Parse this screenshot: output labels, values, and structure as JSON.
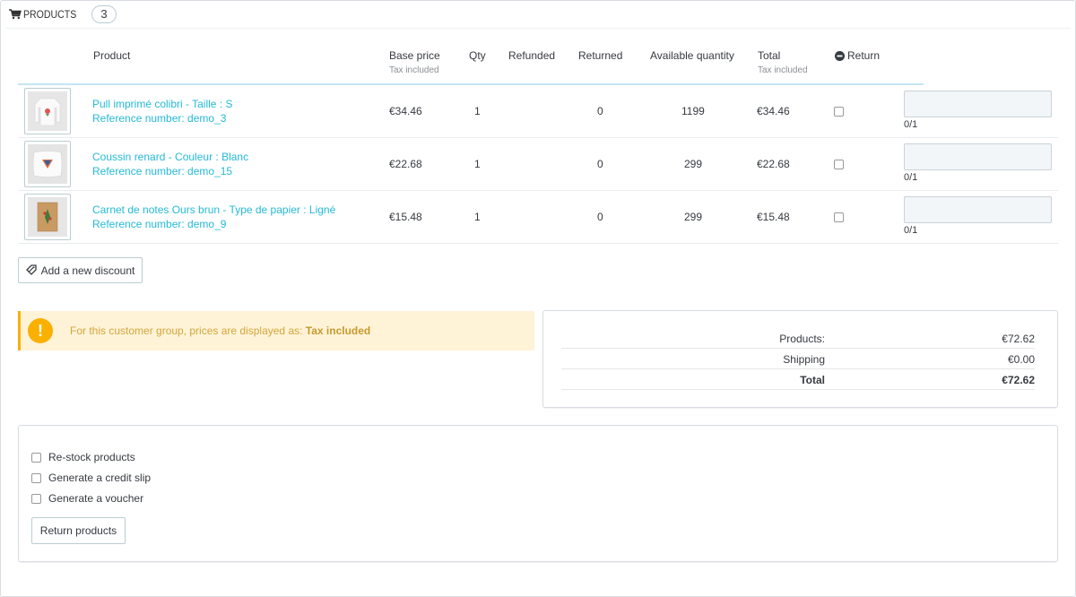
{
  "panel": {
    "title": "Products",
    "count": "3"
  },
  "table": {
    "headers": {
      "product": "Product",
      "base_price": "Base price",
      "base_price_sub": "Tax included",
      "qty": "Qty",
      "refunded": "Refunded",
      "returned": "Returned",
      "available": "Available quantity",
      "total": "Total",
      "total_sub": "Tax included",
      "return": "Return"
    },
    "rows": [
      {
        "name": "Pull imprimé colibri - Taille : S",
        "ref": "Reference number: demo_3",
        "price": "€34.46",
        "qty": "1",
        "refunded": "",
        "returned": "0",
        "available": "1199",
        "total": "€34.46",
        "return_count": "0/1"
      },
      {
        "name": "Coussin renard - Couleur : Blanc",
        "ref": "Reference number: demo_15",
        "price": "€22.68",
        "qty": "1",
        "refunded": "",
        "returned": "0",
        "available": "299",
        "total": "€22.68",
        "return_count": "0/1"
      },
      {
        "name": "Carnet de notes Ours brun - Type de papier : Ligné",
        "ref": "Reference number: demo_9",
        "price": "€15.48",
        "qty": "1",
        "refunded": "",
        "returned": "0",
        "available": "299",
        "total": "€15.48",
        "return_count": "0/1"
      }
    ]
  },
  "actions": {
    "add_discount": "Add a new discount",
    "return_products": "Return products"
  },
  "alert": {
    "text": "For this customer group, prices are displayed as: ",
    "strong": "Tax included"
  },
  "totals": {
    "products_label": "Products:",
    "products_value": "€72.62",
    "shipping_label": "Shipping",
    "shipping_value": "€0.00",
    "total_label": "Total",
    "total_value": "€72.62"
  },
  "options": {
    "restock": "Re-stock products",
    "credit_slip": "Generate a credit slip",
    "voucher": "Generate a voucher"
  },
  "colors": {
    "link": "#25b9d7",
    "warning": "#fab000",
    "warning_bg": "#fff3d7"
  }
}
